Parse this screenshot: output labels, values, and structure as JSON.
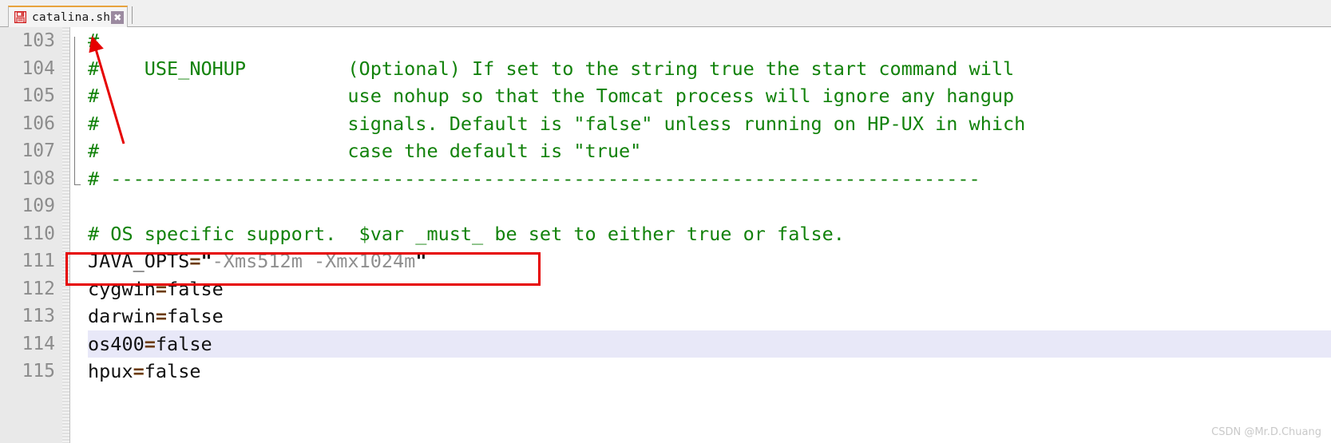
{
  "tab": {
    "label": "catalina.sh",
    "close_label": "✖",
    "icon": "save-floppy-icon",
    "accent_color": "#e8a33d"
  },
  "editor": {
    "first_line_number": 103,
    "current_line_number": 114,
    "colors": {
      "comment": "#12820b",
      "plain": "#111111",
      "operator": "#6b3a06",
      "string": "#8f8f8f",
      "gutter_text": "#8c8c8c",
      "gutter_bg": "#e9e9e9",
      "current_line_bg": "#e8e8f8",
      "annotation": "#e60000"
    },
    "lines": [
      {
        "number": "103",
        "highlight": false,
        "tokens": [
          {
            "kind": "comment",
            "text": "#"
          }
        ]
      },
      {
        "number": "104",
        "highlight": false,
        "tokens": [
          {
            "kind": "comment",
            "text": "#    USE_NOHUP         (Optional) If set to the string true the start command will"
          }
        ]
      },
      {
        "number": "105",
        "highlight": false,
        "tokens": [
          {
            "kind": "comment",
            "text": "#                      use nohup so that the Tomcat process will ignore any hangup"
          }
        ]
      },
      {
        "number": "106",
        "highlight": false,
        "tokens": [
          {
            "kind": "comment",
            "text": "#                      signals. Default is \"false\" unless running on HP-UX in which"
          }
        ]
      },
      {
        "number": "107",
        "highlight": false,
        "tokens": [
          {
            "kind": "comment",
            "text": "#                      case the default is \"true\""
          }
        ]
      },
      {
        "number": "108",
        "highlight": false,
        "tokens": [
          {
            "kind": "comment",
            "text": "# -----------------------------------------------------------------------------"
          }
        ]
      },
      {
        "number": "109",
        "highlight": false,
        "tokens": [
          {
            "kind": "plain",
            "text": ""
          }
        ]
      },
      {
        "number": "110",
        "highlight": false,
        "tokens": [
          {
            "kind": "comment",
            "text": "# OS specific support.  $var _must_ be set to either true or false."
          }
        ]
      },
      {
        "number": "111",
        "highlight": false,
        "tokens": [
          {
            "kind": "plain",
            "text": "JAVA_OPTS"
          },
          {
            "kind": "op",
            "text": "="
          },
          {
            "kind": "quote",
            "text": "\""
          },
          {
            "kind": "string",
            "text": "-Xms512m -Xmx1024m"
          },
          {
            "kind": "quote",
            "text": "\""
          }
        ]
      },
      {
        "number": "112",
        "highlight": false,
        "tokens": [
          {
            "kind": "plain",
            "text": "cygwin"
          },
          {
            "kind": "op",
            "text": "="
          },
          {
            "kind": "plain",
            "text": "false"
          }
        ]
      },
      {
        "number": "113",
        "highlight": false,
        "tokens": [
          {
            "kind": "plain",
            "text": "darwin"
          },
          {
            "kind": "op",
            "text": "="
          },
          {
            "kind": "plain",
            "text": "false"
          }
        ]
      },
      {
        "number": "114",
        "highlight": true,
        "tokens": [
          {
            "kind": "plain",
            "text": "os400"
          },
          {
            "kind": "op",
            "text": "="
          },
          {
            "kind": "plain",
            "text": "false"
          }
        ]
      },
      {
        "number": "115",
        "highlight": false,
        "tokens": [
          {
            "kind": "plain",
            "text": "hpux"
          },
          {
            "kind": "op",
            "text": "="
          },
          {
            "kind": "plain",
            "text": "false"
          }
        ]
      }
    ]
  },
  "annotations": {
    "red_box_target_line": "111",
    "red_arrow_label": ""
  },
  "watermark": {
    "text": "CSDN @Mr.D.Chuang"
  }
}
